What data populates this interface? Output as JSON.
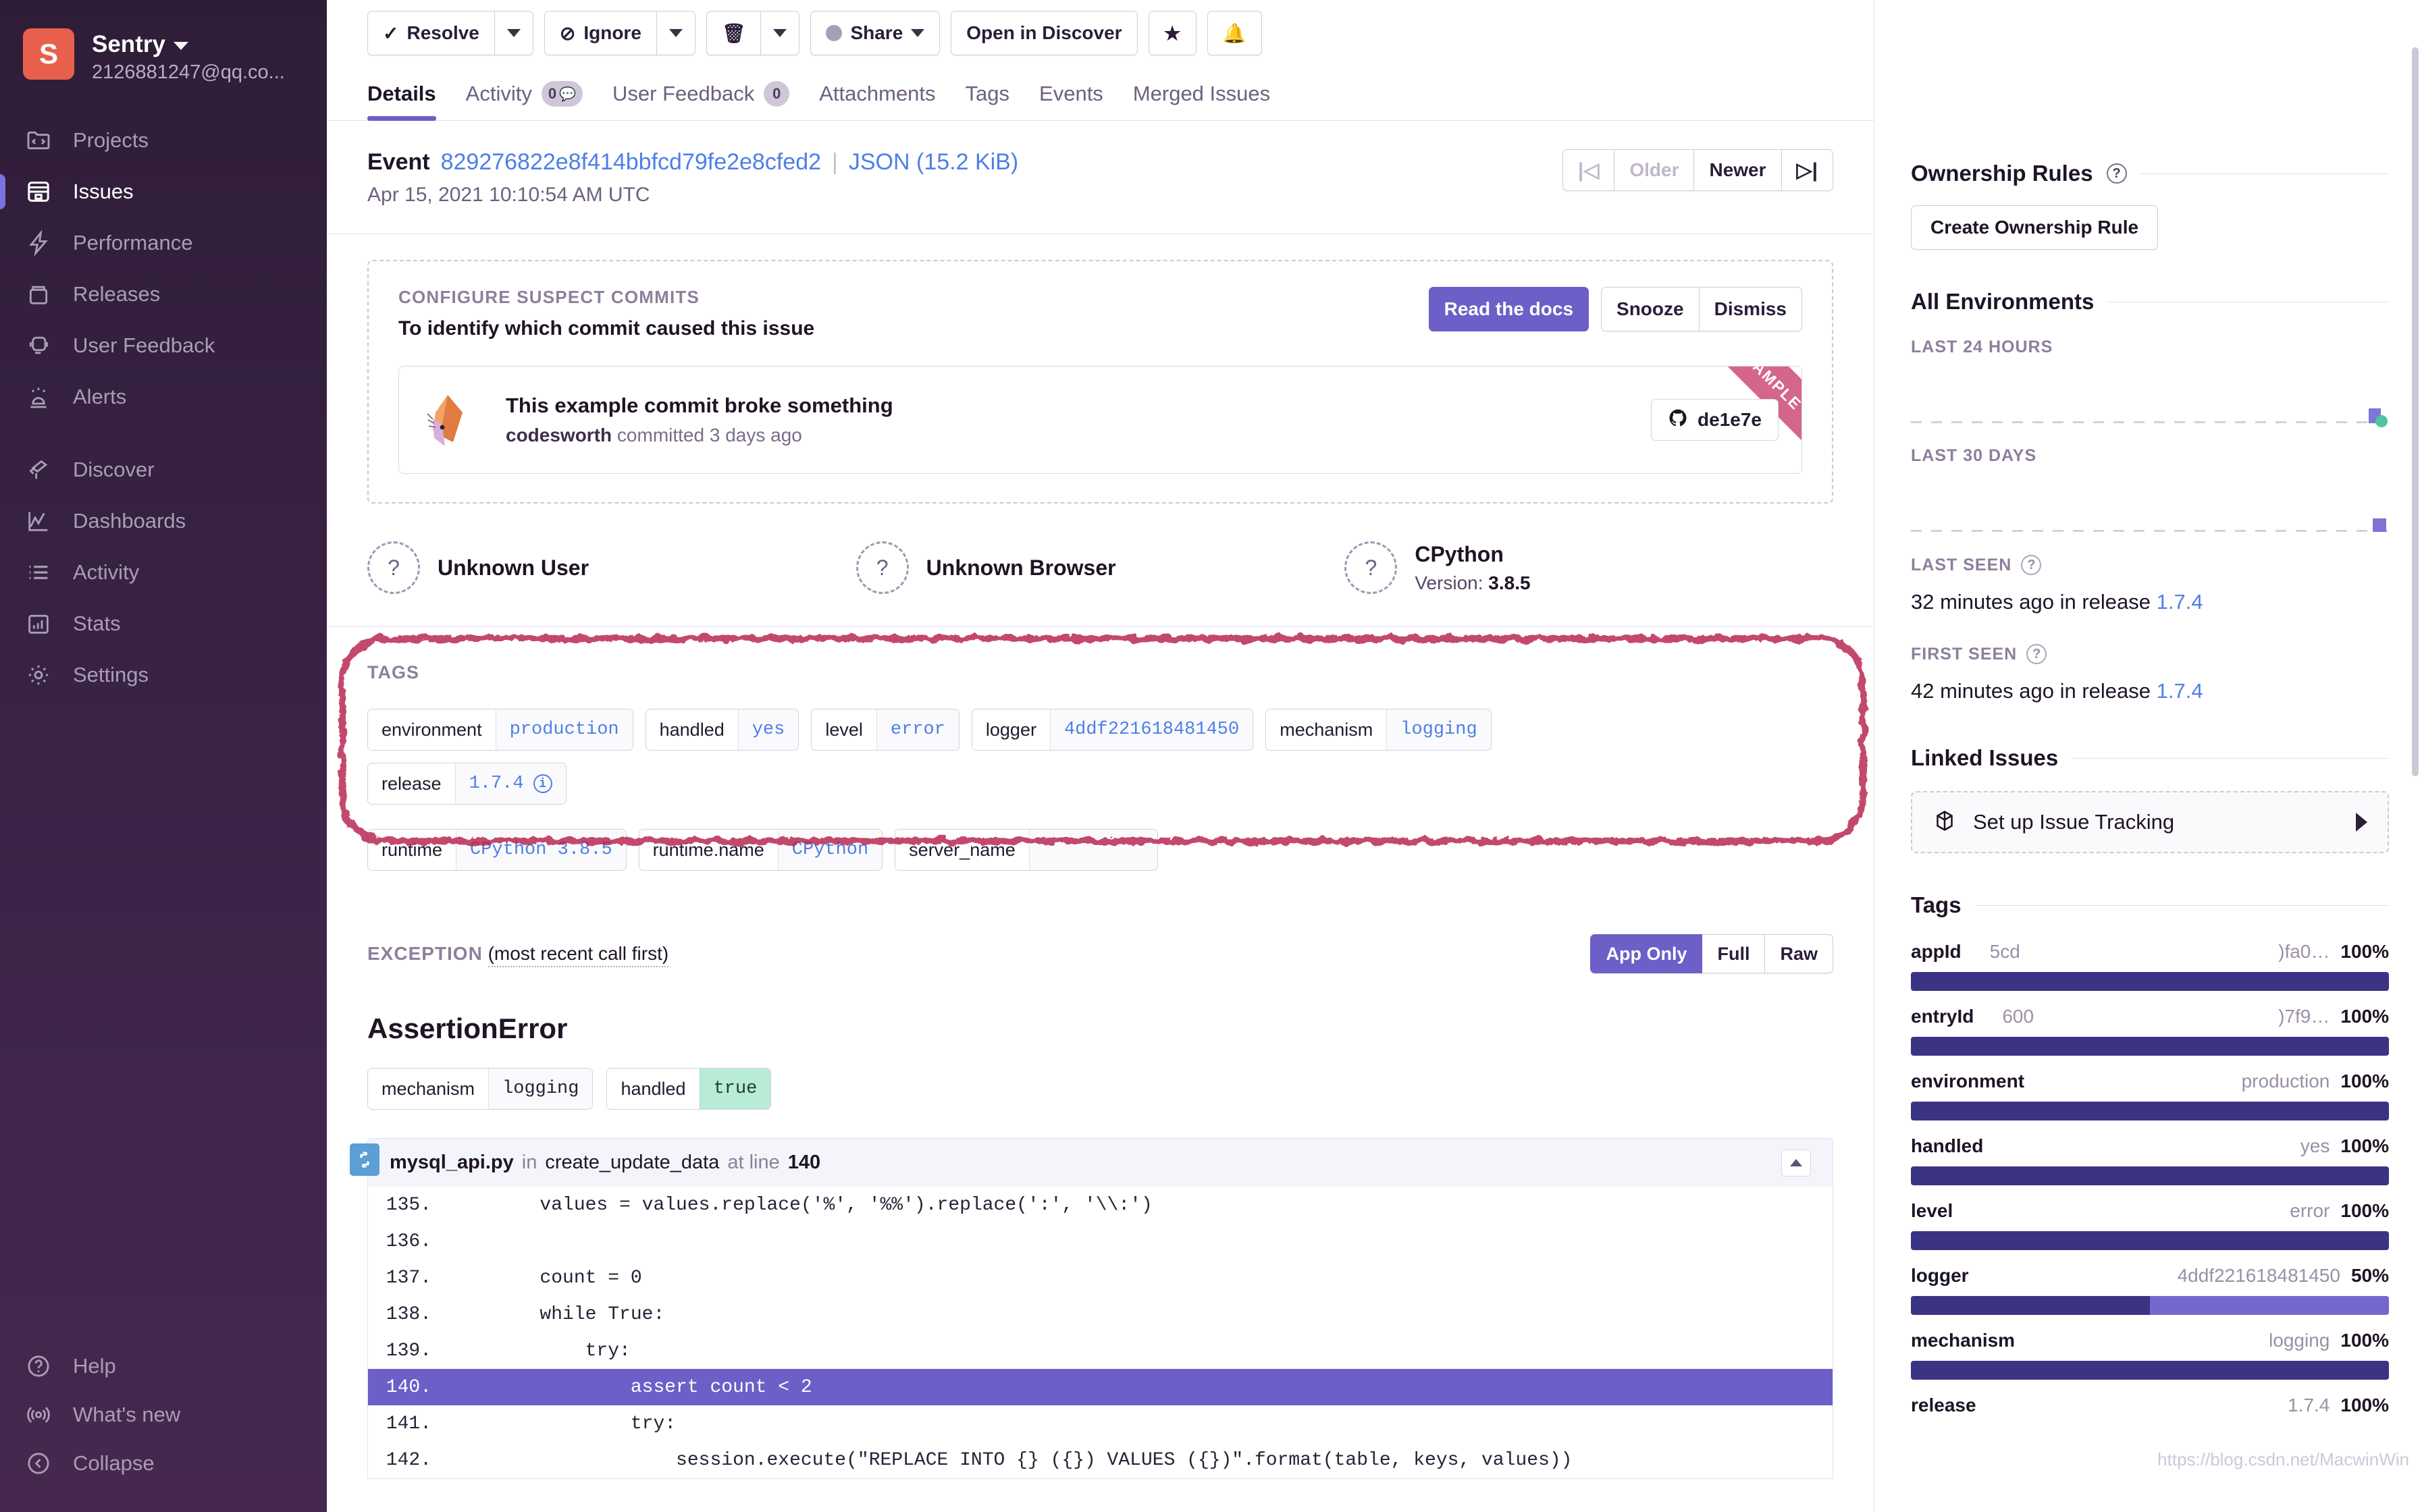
{
  "sidebar": {
    "org_name": "Sentry",
    "org_email": "2126881247@qq.co...",
    "avatar_letter": "S",
    "items": [
      {
        "label": "Projects",
        "icon": "folder-code-icon",
        "active": false
      },
      {
        "label": "Issues",
        "icon": "issues-archive-icon",
        "active": true
      },
      {
        "label": "Performance",
        "icon": "lightning-icon",
        "active": false
      },
      {
        "label": "Releases",
        "icon": "package-icon",
        "active": false
      },
      {
        "label": "User Feedback",
        "icon": "support-icon",
        "active": false
      },
      {
        "label": "Alerts",
        "icon": "siren-icon",
        "active": false
      },
      {
        "label": "Discover",
        "icon": "telescope-icon",
        "active": false
      },
      {
        "label": "Dashboards",
        "icon": "line-chart-icon",
        "active": false
      },
      {
        "label": "Activity",
        "icon": "list-icon",
        "active": false
      },
      {
        "label": "Stats",
        "icon": "bar-chart-icon",
        "active": false
      },
      {
        "label": "Settings",
        "icon": "gear-icon",
        "active": false
      }
    ],
    "bottom_items": [
      {
        "label": "Help",
        "icon": "question-circle-icon"
      },
      {
        "label": "What's new",
        "icon": "broadcast-icon"
      },
      {
        "label": "Collapse",
        "icon": "collapse-left-icon"
      }
    ]
  },
  "toolbar": {
    "resolve": "Resolve",
    "ignore": "Ignore",
    "share": "Share",
    "open_in_discover": "Open in Discover",
    "bookmark_icon": "star-icon",
    "subscribe_icon": "bell-icon",
    "delete_icon": "trash-icon"
  },
  "tabs": [
    {
      "label": "Details",
      "badge": "",
      "active": true
    },
    {
      "label": "Activity",
      "badge": "0",
      "active": false
    },
    {
      "label": "User Feedback",
      "badge": "0",
      "active": false
    },
    {
      "label": "Attachments",
      "badge": "",
      "active": false
    },
    {
      "label": "Tags",
      "badge": "",
      "active": false
    },
    {
      "label": "Events",
      "badge": "",
      "active": false
    },
    {
      "label": "Merged Issues",
      "badge": "",
      "active": false
    }
  ],
  "event": {
    "label": "Event",
    "id": "829276822e8f414bbfcd79fe2e8cfed2",
    "json_link": "JSON (15.2 KiB)",
    "date": "Apr 15, 2021 10:10:54 AM UTC",
    "nav": {
      "first": "|◁",
      "older": "Older",
      "newer": "Newer",
      "last": "▷|"
    }
  },
  "suspect_commits": {
    "label": "CONFIGURE SUSPECT COMMITS",
    "subtitle": "To identify which commit caused this issue",
    "read_docs": "Read the docs",
    "snooze": "Snooze",
    "dismiss": "Dismiss",
    "commit_title": "This example commit broke something",
    "commit_author": "codesworth",
    "commit_meta": "committed 3 days ago",
    "commit_sha": "de1e7e",
    "ribbon": "EXAMPLE"
  },
  "contexts": [
    {
      "name": "Unknown User",
      "version_label": "",
      "version": "",
      "icon": "question-avatar-icon"
    },
    {
      "name": "Unknown Browser",
      "version_label": "",
      "version": "",
      "icon": "question-avatar-icon"
    },
    {
      "name": "CPython",
      "version_label": "Version:",
      "version": "3.8.5",
      "icon": "question-avatar-icon"
    }
  ],
  "tags_section": {
    "title": "TAGS",
    "annotation_color": "#b6204e",
    "tags": [
      {
        "key": "environment",
        "value": "production",
        "info": false
      },
      {
        "key": "handled",
        "value": "yes",
        "info": false
      },
      {
        "key": "level",
        "value": "error",
        "info": false
      },
      {
        "key": "logger",
        "value": "4ddf221618481450",
        "info": false
      },
      {
        "key": "mechanism",
        "value": "logging",
        "info": false
      },
      {
        "key": "release",
        "value": "1.7.4",
        "info": true
      },
      {
        "key": "runtime",
        "value": "CPython 3.8.5",
        "info": false
      },
      {
        "key": "runtime.name",
        "value": "CPython",
        "info": false
      },
      {
        "key": "server_name",
        "value": "",
        "info": false
      }
    ]
  },
  "exception": {
    "label": "EXCEPTION",
    "suffix": "(most recent call first)",
    "view_modes": [
      {
        "label": "App Only",
        "active": true
      },
      {
        "label": "Full",
        "active": false
      },
      {
        "label": "Raw",
        "active": false
      }
    ],
    "title": "AssertionError",
    "tags": [
      {
        "key": "mechanism",
        "value": "logging",
        "highlight": false
      },
      {
        "key": "handled",
        "value": "true",
        "highlight": true
      }
    ],
    "frame": {
      "file": "mysql_api.py",
      "in_word": "in",
      "function": "create_update_data",
      "at_word": "at line",
      "line": "140",
      "platform_icon": "python-icon",
      "lines": [
        {
          "no": "135.",
          "code": "        values = values.replace('%', '%%').replace(':', '\\\\:')",
          "highlight": false
        },
        {
          "no": "136.",
          "code": "",
          "highlight": false
        },
        {
          "no": "137.",
          "code": "        count = 0",
          "highlight": false
        },
        {
          "no": "138.",
          "code": "        while True:",
          "highlight": false
        },
        {
          "no": "139.",
          "code": "            try:",
          "highlight": false
        },
        {
          "no": "140.",
          "code": "                assert count < 2",
          "highlight": true
        },
        {
          "no": "141.",
          "code": "                try:",
          "highlight": false
        },
        {
          "no": "142.",
          "code": "                    session.execute(\"REPLACE INTO {} ({}) VALUES ({})\".format(table, keys, values))",
          "highlight": false
        }
      ]
    }
  },
  "right": {
    "ownership_title": "Ownership Rules",
    "create_ownership_rule": "Create Ownership Rule",
    "all_environments": "All Environments",
    "last_24_hours": "LAST 24 HOURS",
    "last_30_days": "LAST 30 DAYS",
    "last_seen_label": "LAST SEEN",
    "last_seen_value": "32 minutes ago in release ",
    "last_seen_release": "1.7.4",
    "first_seen_label": "FIRST SEEN",
    "first_seen_value": "42 minutes ago in release ",
    "first_seen_release": "1.7.4",
    "linked_issues_title": "Linked Issues",
    "set_up_issue_tracking": "Set up Issue Tracking",
    "tags_title": "Tags",
    "tag_stats": [
      {
        "key": "appId",
        "mid": "5cd",
        "value": ")fa0…",
        "percent": "100%",
        "pct_num": 100
      },
      {
        "key": "entryId",
        "mid": "600",
        "value": ")7f9…",
        "percent": "100%",
        "pct_num": 100
      },
      {
        "key": "environment",
        "mid": "",
        "value": "production",
        "percent": "100%",
        "pct_num": 100
      },
      {
        "key": "handled",
        "mid": "",
        "value": "yes",
        "percent": "100%",
        "pct_num": 100
      },
      {
        "key": "level",
        "mid": "",
        "value": "error",
        "percent": "100%",
        "pct_num": 100
      },
      {
        "key": "logger",
        "mid": "",
        "value": "4ddf221618481450",
        "percent": "50%",
        "pct_num": 50
      },
      {
        "key": "mechanism",
        "mid": "",
        "value": "logging",
        "percent": "100%",
        "pct_num": 100
      },
      {
        "key": "release",
        "mid": "",
        "value": "1.7.4",
        "percent": "100%",
        "pct_num": 100
      }
    ]
  },
  "watermark": "https://blog.csdn.net/MacwinWin"
}
